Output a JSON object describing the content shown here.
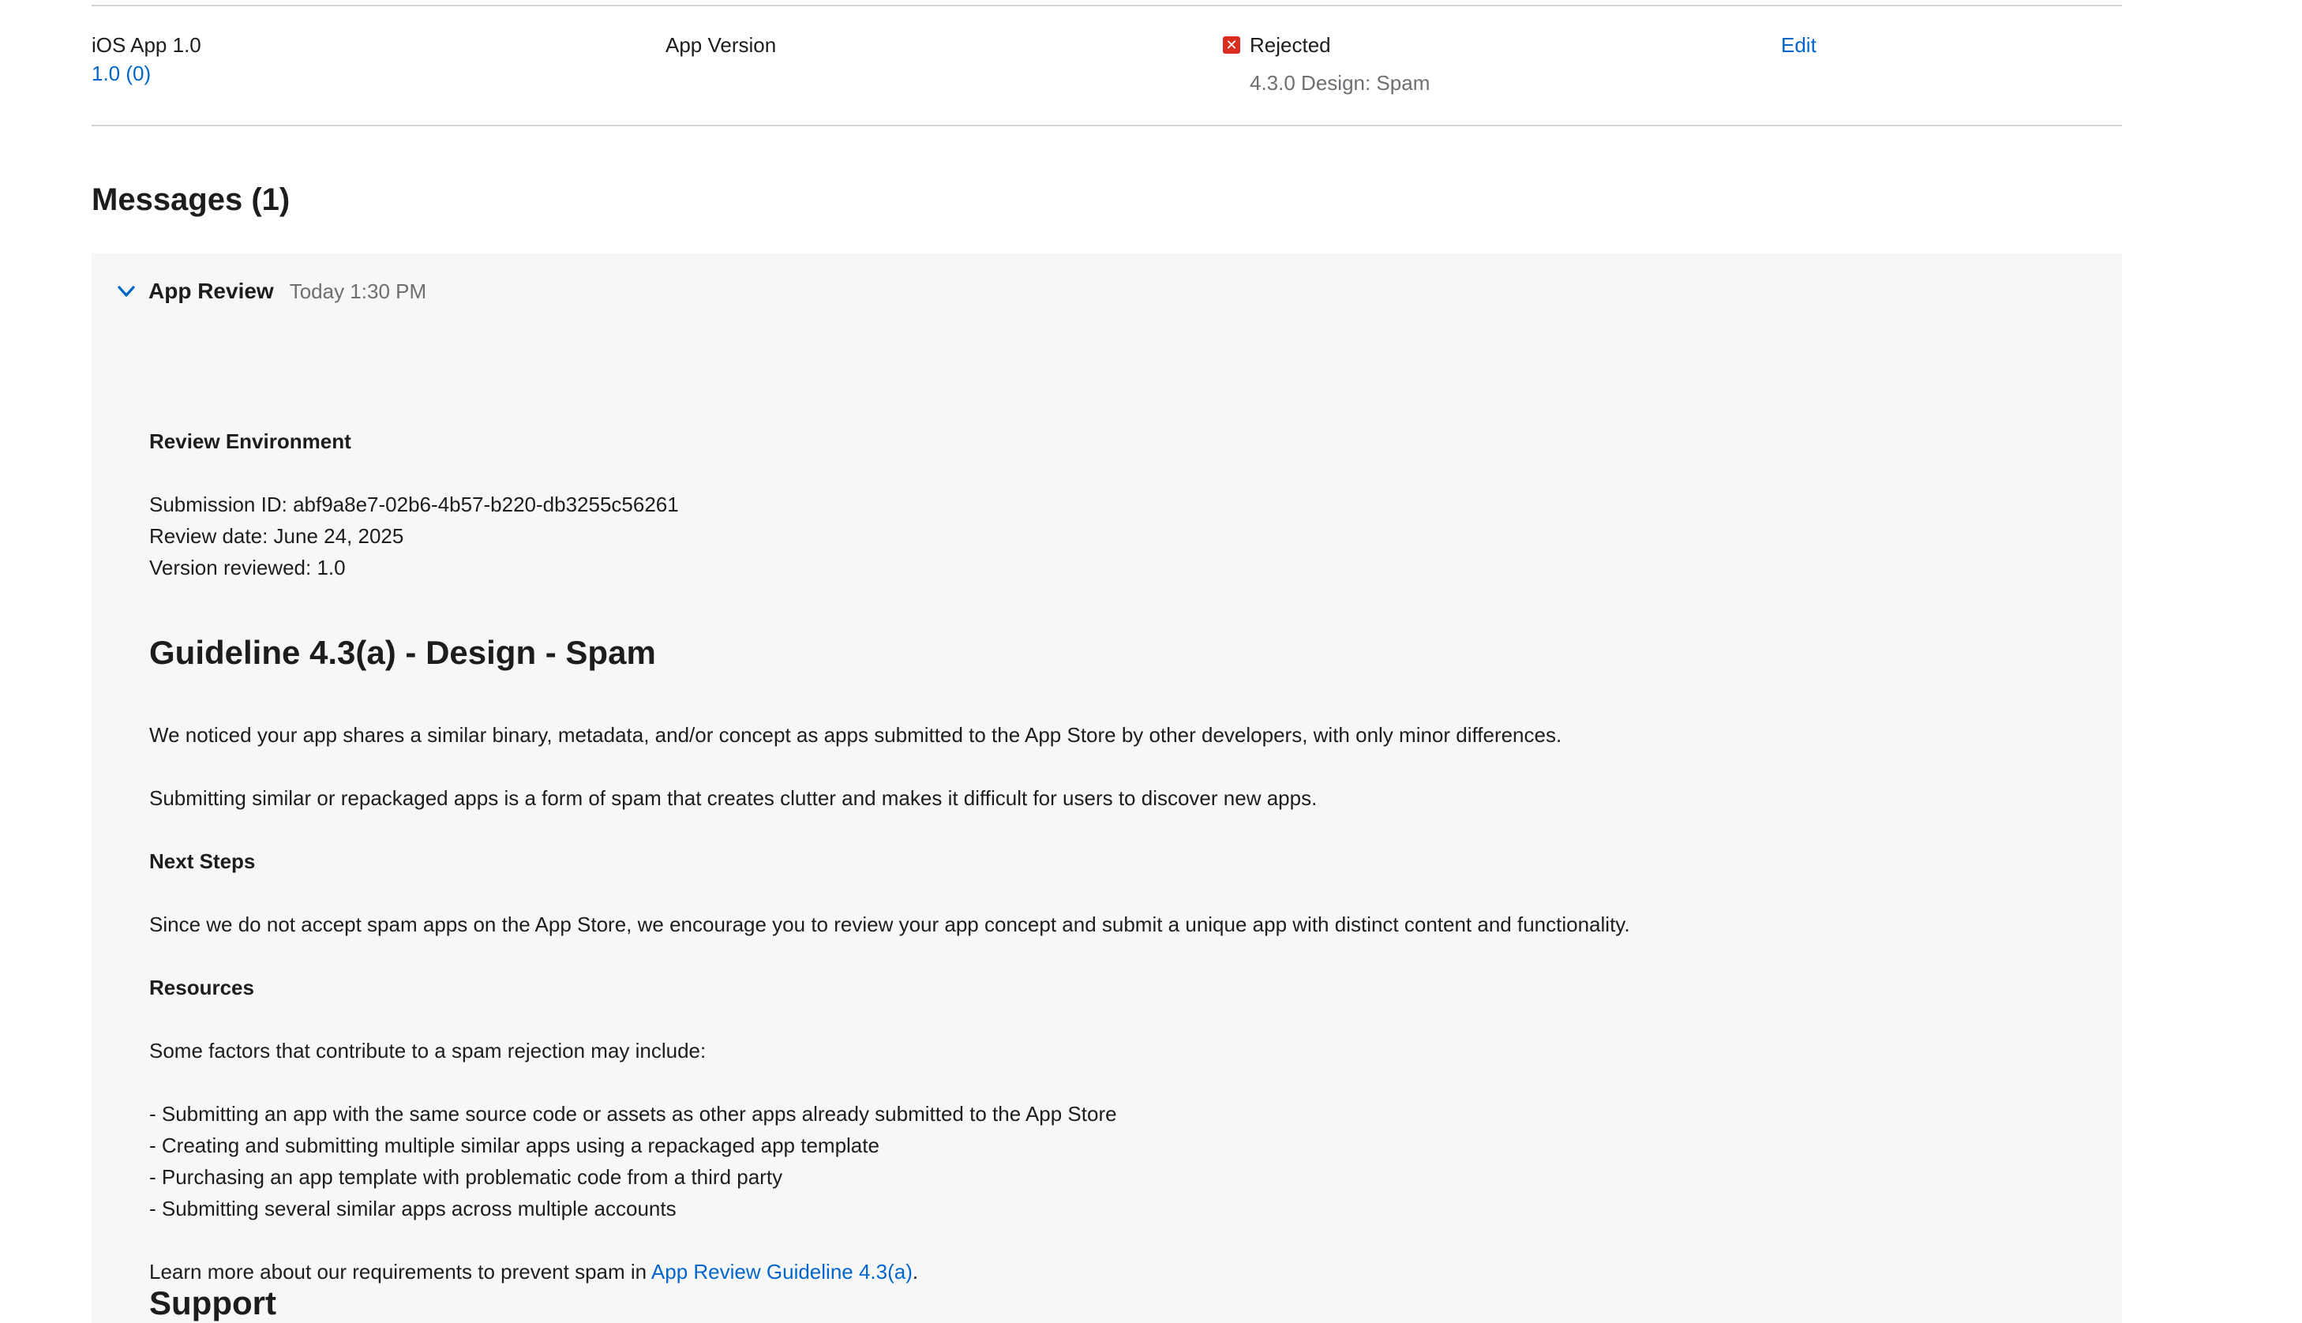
{
  "build_row": {
    "app_name": "iOS App 1.0",
    "app_version_link": "1.0 (0)",
    "type": "App Version",
    "status": "Rejected",
    "status_color": "#d92d20",
    "status_icon": "x-square-icon",
    "status_reason": "4.3.0 Design: Spam",
    "action": "Edit"
  },
  "messages": {
    "title": "Messages (1)",
    "items": [
      {
        "sender": "App Review",
        "time": "Today 1:30 PM",
        "expand_icon": "chevron-down-icon",
        "review_env_heading": "Review Environment",
        "submission_id": "Submission ID: abf9a8e7-02b6-4b57-b220-db3255c56261",
        "review_date": "Review date: June 24, 2025",
        "version_reviewed": "Version reviewed: 1.0",
        "guideline_title": "Guideline 4.3(a) - Design - Spam",
        "para1": "We noticed your app shares a similar binary, metadata, and/or concept as apps submitted to the App Store by other developers, with only minor differences.",
        "para2": "Submitting similar or repackaged apps is a form of spam that creates clutter and makes it difficult for users to discover new apps.",
        "next_steps_heading": "Next Steps",
        "para3": "Since we do not accept spam apps on the App Store, we encourage you to review your app concept and submit a unique app with distinct content and functionality.",
        "resources_heading": "Resources",
        "para4": "Some factors that contribute to a spam rejection may include:",
        "factors": [
          "- Submitting an app with the same source code or assets as other apps already submitted to the App Store",
          "- Creating and submitting multiple similar apps using a repackaged app template",
          "- Purchasing an app template with problematic code from a third party",
          "- Submitting several similar apps across multiple accounts"
        ],
        "learn_more_prefix": "Learn more about our requirements to prevent spam in ",
        "learn_more_link": "App Review Guideline 4.3(a)",
        "learn_more_suffix": ".",
        "cut_heading": "Support"
      }
    ]
  },
  "colors": {
    "accent": "#0066cc",
    "card_bg": "#f7f7f7",
    "divider": "#d2d2d7",
    "secondary_text": "#6e6e73"
  }
}
